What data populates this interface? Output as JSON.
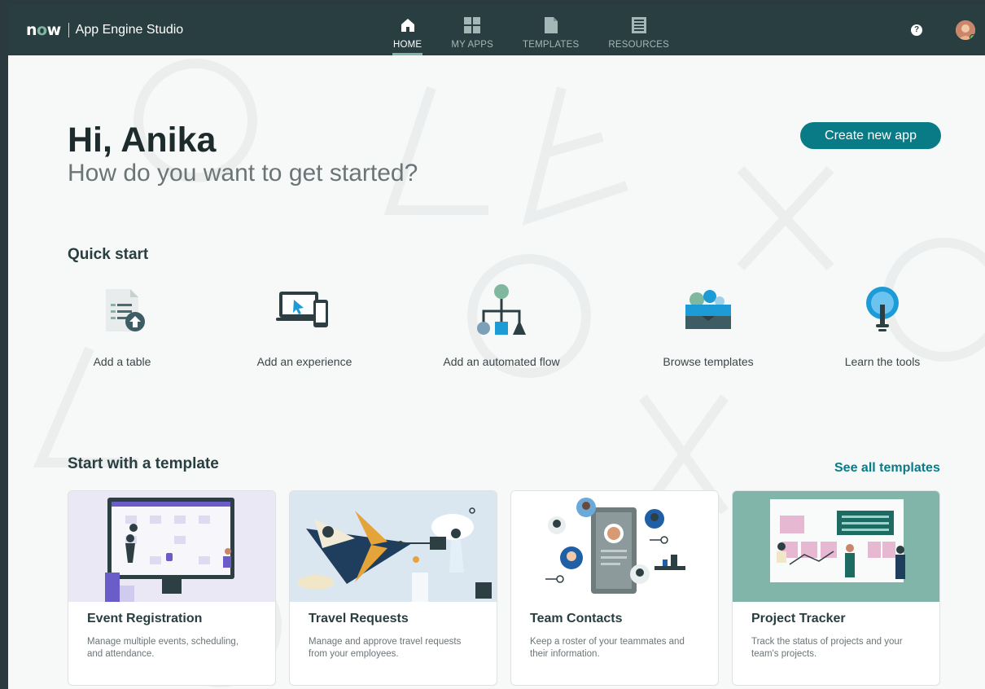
{
  "header": {
    "logo": "now",
    "app_title": "App Engine Studio",
    "nav": [
      {
        "label": "HOME",
        "icon": "home-icon",
        "active": true
      },
      {
        "label": "MY APPS",
        "icon": "grid-icon",
        "active": false
      },
      {
        "label": "TEMPLATES",
        "icon": "document-icon",
        "active": false
      },
      {
        "label": "RESOURCES",
        "icon": "book-icon",
        "active": false
      }
    ],
    "help_glyph": "?"
  },
  "main": {
    "greeting": "Hi, Anika",
    "subtitle": "How do you want to get started?",
    "create_button": "Create new app",
    "quick_start": {
      "title": "Quick start",
      "items": [
        {
          "label": "Add a table",
          "icon": "table-upload-icon"
        },
        {
          "label": "Add an experience",
          "icon": "devices-icon"
        },
        {
          "label": "Add an automated flow",
          "icon": "flow-icon"
        },
        {
          "label": "Browse templates",
          "icon": "template-box-icon"
        },
        {
          "label": "Learn the tools",
          "icon": "lightbulb-icon"
        }
      ]
    },
    "templates": {
      "title": "Start with a template",
      "see_all": "See all templates",
      "cards": [
        {
          "title": "Event Registration",
          "description": "Manage multiple events, scheduling, and attendance."
        },
        {
          "title": "Travel Requests",
          "description": "Manage and approve travel requests from your employees."
        },
        {
          "title": "Team Contacts",
          "description": "Keep a roster of your teammates and their information."
        },
        {
          "title": "Project Tracker",
          "description": "Track the status of projects and your team's projects."
        }
      ]
    }
  },
  "colors": {
    "header_bg": "#293e40",
    "accent_teal": "#097b86",
    "nav_indicator": "#81b5a1",
    "page_bg": "#f7f8f8"
  }
}
